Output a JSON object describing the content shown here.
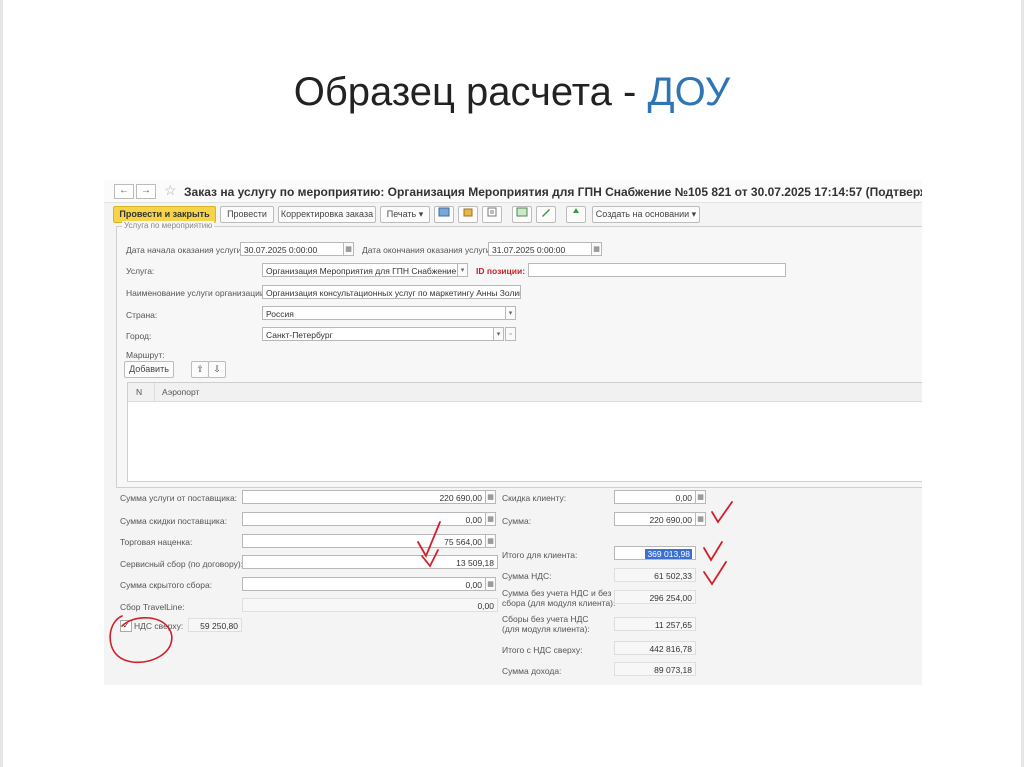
{
  "slide": {
    "title_main": "Образец расчета - ",
    "title_accent": "ДОУ"
  },
  "window": {
    "back": "←",
    "forward": "→",
    "favorite": "☆",
    "title": "Заказ на услугу по мероприятию: Организация Мероприятия для ГПН Снабжение №105 821 от 30.07.2025 17:14:57 (Подтвержден) *"
  },
  "toolbar": {
    "post_close": "Провести и закрыть",
    "post": "Провести",
    "correct_order": "Корректировка заказа",
    "print": "Печать ▾",
    "create_basis": "Создать на основании ▾"
  },
  "group": {
    "caption": "Услуга по мероприятию"
  },
  "form": {
    "start_date_label": "Дата начала оказания услуги:",
    "start_date_value": "30.07.2025  0:00:00",
    "end_date_label": "Дата окончания оказания услуги:",
    "end_date_value": "31.07.2025  0:00:00",
    "service_label": "Услуга:",
    "service_value": "Организация Мероприятия для ГПН Снабжение",
    "position_id_label": "ID позиции:",
    "position_id_value": "",
    "org_service_name_label": "Наименование услуги организации:",
    "org_service_name_value": "Организация консультационных услуг по маркетингу Анны Золиной",
    "country_label": "Страна:",
    "country_value": "Россия",
    "city_label": "Город:",
    "city_value": "Санкт-Петербург",
    "route_label": "Маршрут:",
    "add_button": "Добавить",
    "up": "⇧",
    "down": "⇩"
  },
  "route_table": {
    "columns": [
      "N",
      "Аэропорт"
    ]
  },
  "amounts_left": {
    "supplier_sum_label": "Сумма услуги от поставщика:",
    "supplier_sum_value": "220 690,00",
    "supplier_discount_label": "Сумма скидки поставщика:",
    "supplier_discount_value": "0,00",
    "markup_label": "Торговая наценка:",
    "markup_value": "75 564,00",
    "service_fee_label": "Сервисный сбор (по договору):",
    "service_fee_value": "13 509,18",
    "hidden_fee_label": "Сумма скрытого сбора:",
    "hidden_fee_value": "0,00",
    "travelline_label": "Сбор TravelLine:",
    "travelline_value": "0,00",
    "vat_on_top_label": "НДС сверху:",
    "vat_on_top_value": "59 250,80",
    "vat_checked": "✓"
  },
  "amounts_right": {
    "client_discount_label": "Скидка клиенту:",
    "client_discount_value": "0,00",
    "sum_label": "Сумма:",
    "sum_value": "220 690,00",
    "client_total_label": "Итого для клиента:",
    "client_total_value": "369 013,98",
    "vat_sum_label": "Сумма НДС:",
    "vat_sum_value": "61 502,33",
    "sum_no_vat_label_1": "Сумма без учета НДС и без",
    "sum_no_vat_label_2": "сбора (для модуля клиента):",
    "sum_no_vat_value": "296 254,00",
    "fees_no_vat_label_1": "Сборы без учета НДС",
    "fees_no_vat_label_2": "(для модуля клиента):",
    "fees_no_vat_value": "11 257,65",
    "total_vat_on_top_label": "Итого с НДС сверху:",
    "total_vat_on_top_value": "442 816,78",
    "income_label": "Сумма дохода:",
    "income_value": "89 073,18"
  },
  "colors": {
    "accent": "#2e75b6",
    "primary_button": "#f5d547",
    "ink": "#d0202a",
    "selection": "#3b6fd1"
  }
}
